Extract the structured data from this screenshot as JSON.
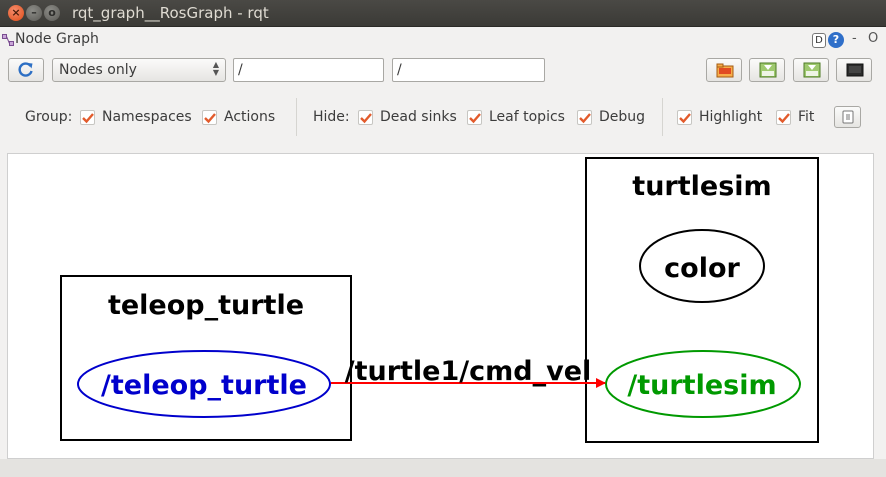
{
  "window": {
    "title": "rqt_graph__RosGraph - rqt",
    "close_glyph": "×",
    "min_glyph": "–",
    "max_glyph": "o"
  },
  "plugin": {
    "title": "Node Graph",
    "help_d": "D",
    "help_q": "?",
    "dash": "-",
    "o": "O"
  },
  "toolbar": {
    "display_mode": "Nodes only",
    "namespace_filter": "/",
    "topic_filter": "/"
  },
  "options": {
    "group_label": "Group:",
    "namespaces": "Namespaces",
    "actions": "Actions",
    "hide_label": "Hide:",
    "dead_sinks": "Dead sinks",
    "leaf_topics": "Leaf topics",
    "debug": "Debug",
    "highlight": "Highlight",
    "fit": "Fit"
  },
  "graph": {
    "cluster_teleop": "teleop_turtle",
    "node_teleop": "/teleop_turtle",
    "cluster_turtlesim": "turtlesim",
    "node_color": "color",
    "node_turtlesim": "/turtlesim",
    "edge_topic": "/turtle1/cmd_vel"
  },
  "colors": {
    "teleop_node": "#0000cc",
    "turtlesim_node": "#009900",
    "edge": "#ff0000",
    "checkbox": "#e25b2c"
  }
}
